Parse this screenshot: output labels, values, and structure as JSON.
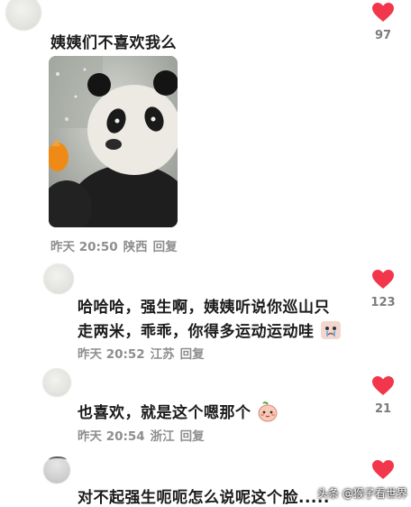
{
  "colors": {
    "heart": "#f2364b",
    "meta": "#8e8e8e",
    "text": "#1b1b1b"
  },
  "comments": [
    {
      "text": "姨姨们不喜欢我么",
      "time": "昨天 20:50",
      "location": "陕西",
      "reply": "回复",
      "likes": "97",
      "image": "panda-photo"
    },
    {
      "line1": "哈哈哈，强生啊，姨姨听说你巡山只",
      "line2": "走两米，乖乖，你得多运动运动哇",
      "time": "昨天 20:52",
      "location": "江苏",
      "reply": "回复",
      "likes": "123",
      "emoji": "crying-sticker-icon"
    },
    {
      "text": "也喜欢，就是这个嗯那个",
      "time": "昨天 20:54",
      "location": "浙江",
      "reply": "回复",
      "likes": "21",
      "emoji": "blushing-peach-icon"
    },
    {
      "text": "对不起强生呃呃怎么说呢这个脸.....",
      "likes": ""
    }
  ],
  "watermark": "头条 @猴子看世界"
}
